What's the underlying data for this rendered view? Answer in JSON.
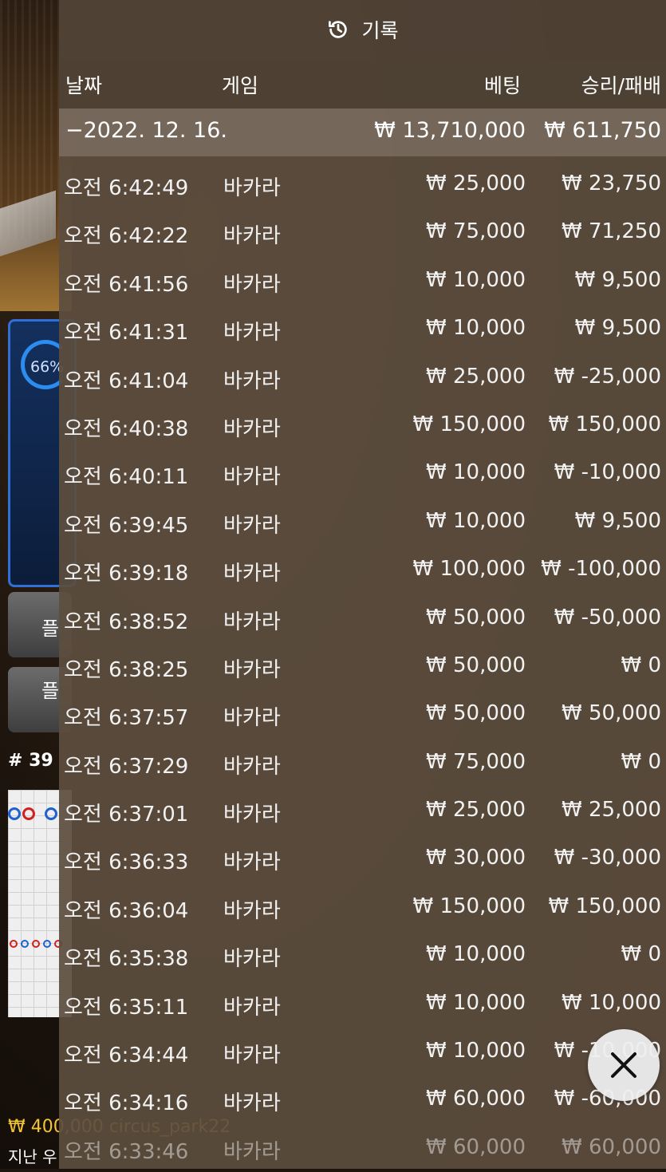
{
  "background": {
    "gauge_percent": "66%",
    "player_button_label": "플",
    "player_pair_label": "플",
    "round_label": "# 39",
    "balance_line": "₩ 400,000 circus_park22",
    "last_line": "지난 우"
  },
  "history": {
    "title": "기록",
    "columns": {
      "date": "날짜",
      "game": "게임",
      "bet": "베팅",
      "win_loss": "승리/패배"
    },
    "date_group": {
      "date": "−2022. 12. 16.",
      "bet": "₩ 13,710,000",
      "win_loss": "₩ 611,750"
    },
    "rows": [
      {
        "time": "오전 6:42:49",
        "game": "바카라",
        "bet": "₩ 25,000",
        "win_loss": "₩ 23,750"
      },
      {
        "time": "오전 6:42:22",
        "game": "바카라",
        "bet": "₩ 75,000",
        "win_loss": "₩ 71,250"
      },
      {
        "time": "오전 6:41:56",
        "game": "바카라",
        "bet": "₩ 10,000",
        "win_loss": "₩ 9,500"
      },
      {
        "time": "오전 6:41:31",
        "game": "바카라",
        "bet": "₩ 10,000",
        "win_loss": "₩ 9,500"
      },
      {
        "time": "오전 6:41:04",
        "game": "바카라",
        "bet": "₩ 25,000",
        "win_loss": "₩ -25,000"
      },
      {
        "time": "오전 6:40:38",
        "game": "바카라",
        "bet": "₩ 150,000",
        "win_loss": "₩ 150,000"
      },
      {
        "time": "오전 6:40:11",
        "game": "바카라",
        "bet": "₩ 10,000",
        "win_loss": "₩ -10,000"
      },
      {
        "time": "오전 6:39:45",
        "game": "바카라",
        "bet": "₩ 10,000",
        "win_loss": "₩ 9,500"
      },
      {
        "time": "오전 6:39:18",
        "game": "바카라",
        "bet": "₩ 100,000",
        "win_loss": "₩ -100,000"
      },
      {
        "time": "오전 6:38:52",
        "game": "바카라",
        "bet": "₩ 50,000",
        "win_loss": "₩ -50,000"
      },
      {
        "time": "오전 6:38:25",
        "game": "바카라",
        "bet": "₩ 50,000",
        "win_loss": "₩ 0"
      },
      {
        "time": "오전 6:37:57",
        "game": "바카라",
        "bet": "₩ 50,000",
        "win_loss": "₩ 50,000"
      },
      {
        "time": "오전 6:37:29",
        "game": "바카라",
        "bet": "₩ 75,000",
        "win_loss": "₩ 0"
      },
      {
        "time": "오전 6:37:01",
        "game": "바카라",
        "bet": "₩ 25,000",
        "win_loss": "₩ 25,000"
      },
      {
        "time": "오전 6:36:33",
        "game": "바카라",
        "bet": "₩ 30,000",
        "win_loss": "₩ -30,000"
      },
      {
        "time": "오전 6:36:04",
        "game": "바카라",
        "bet": "₩ 150,000",
        "win_loss": "₩ 150,000"
      },
      {
        "time": "오전 6:35:38",
        "game": "바카라",
        "bet": "₩ 10,000",
        "win_loss": "₩ 0"
      },
      {
        "time": "오전 6:35:11",
        "game": "바카라",
        "bet": "₩ 10,000",
        "win_loss": "₩ 10,000"
      },
      {
        "time": "오전 6:34:44",
        "game": "바카라",
        "bet": "₩ 10,000",
        "win_loss": "₩ -10,000"
      },
      {
        "time": "오전 6:34:16",
        "game": "바카라",
        "bet": "₩ 60,000",
        "win_loss": "₩ -60,000"
      },
      {
        "time": "오전 6:33:46",
        "game": "바카라",
        "bet": "₩ 60,000",
        "win_loss": "₩ 60,000"
      }
    ],
    "close_icon": "close-icon",
    "history_icon": "history-icon"
  }
}
